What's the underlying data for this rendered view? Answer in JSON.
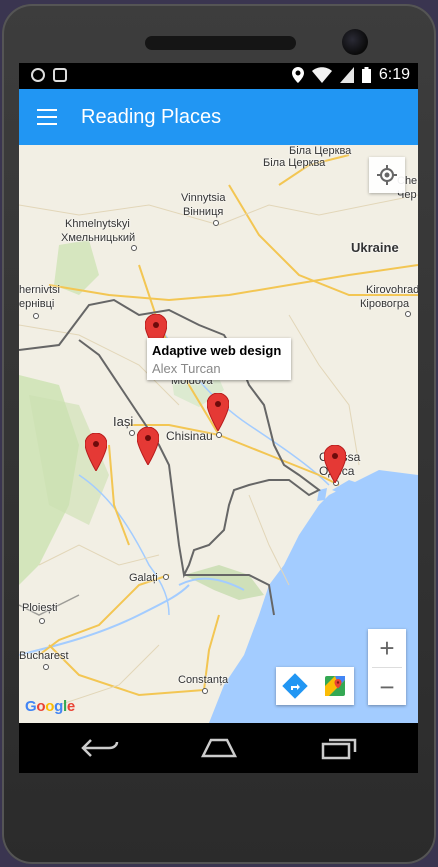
{
  "status_bar": {
    "time": "6:19"
  },
  "app_bar": {
    "title": "Reading Places"
  },
  "map": {
    "labels": {
      "kiev_ua": "Біла Церква",
      "bila_tserkva": "Bila Tserkva",
      "vinnytsia": "Vinnytsia",
      "vinnytsia_ua": "Вінниця",
      "khmelnytskyi": "Khmelnytskyi",
      "khmelnytskyi_ua": "Хмельницький",
      "ukraine": "Ukraine",
      "kirovohrad": "Kirovohrad",
      "kirovohrad_ua": "Кіровогра",
      "chernivtsi": "hernivtsi",
      "chernivtsi_ua": "ернівці",
      "iasi": "Iași",
      "chisinau": "Chisinau",
      "moldova": "Moldova",
      "odessa": "Odessa",
      "odessa_ua": "Одеса",
      "galati": "Galați",
      "ploiesti": "Ploiești",
      "bucharest": "Bucharest",
      "constanta": "Constanța",
      "cherkasy_partial": "Che",
      "cherkasy_partial_ua": "Чер"
    },
    "info_window": {
      "title": "Adaptive web design",
      "author": "Alex Turcan"
    },
    "zoom_in": "+",
    "zoom_out": "−",
    "google_logo": {
      "g": "G",
      "o1": "o",
      "o2": "o",
      "g2": "g",
      "l": "l",
      "e": "e"
    },
    "colors": {
      "marker": "#e53935",
      "water": "#a3ccff",
      "park": "#cfe3b4",
      "road": "#f6cf65"
    }
  }
}
